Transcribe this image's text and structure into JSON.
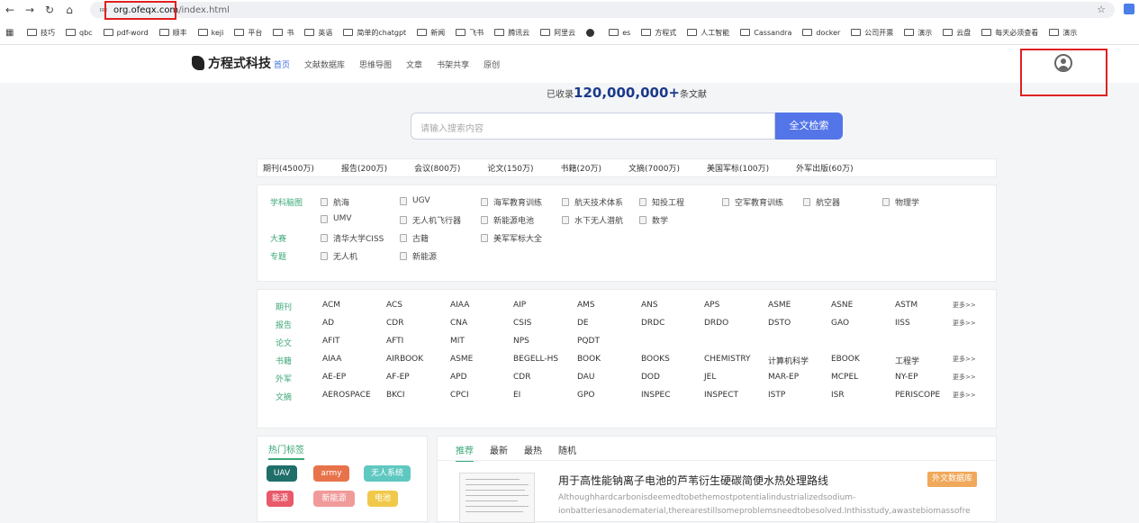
{
  "browser": {
    "url_host": "org.ofeqx.com",
    "url_path": "/index.html",
    "bookmarks": [
      "技巧",
      "qbc",
      "pdf-word",
      "顺丰",
      "keji",
      "平台",
      "书",
      "英语",
      "简单的chatgpt",
      "新闻",
      "飞书",
      "腾讯云",
      "阿里云",
      "",
      "es",
      "方程式",
      "人工智能",
      "Cassandra",
      "docker",
      "公司开票",
      "演示",
      "云盘",
      "每天必须查看",
      "演示"
    ]
  },
  "header": {
    "logo_text": "方程式科技",
    "nav": [
      "首页",
      "文献数据库",
      "思维导图",
      "文章",
      "书架共享",
      "原创"
    ]
  },
  "count": {
    "prefix": "已收录",
    "number": "120,000,000+",
    "suffix": "条文献"
  },
  "search": {
    "placeholder": "请输入搜索内容",
    "button": "全文检索"
  },
  "stats": [
    "期刊(4500万)",
    "报告(200万)",
    "会议(800万)",
    "论文(150万)",
    "书籍(20万)",
    "文摘(7000万)",
    "美国军标(100万)",
    "外军出版(60万)"
  ],
  "subjects": {
    "label_map": "学科脑图",
    "label_big": "大赛",
    "label_topic": "专题",
    "items": [
      "航海",
      "UGV",
      "海军教育训练",
      "航天技术体系",
      "知投工程",
      "空军教育训练",
      "航空器",
      "物理学",
      "UMV",
      "无人机飞行器",
      "新能源电池",
      "水下无人潜航",
      "数学",
      "清华大学CISS",
      "古籍",
      "美军军标大全",
      "无人机",
      "新能源"
    ]
  },
  "db": {
    "more": "更多>>",
    "rows": [
      {
        "label": "期刊",
        "cells": [
          "ACM",
          "ACS",
          "AIAA",
          "AIP",
          "AMS",
          "ANS",
          "APS",
          "ASME",
          "ASNE",
          "ASTM"
        ],
        "more": true
      },
      {
        "label": "报告",
        "cells": [
          "AD",
          "CDR",
          "CNA",
          "CSIS",
          "DE",
          "DRDC",
          "DRDO",
          "DSTO",
          "GAO",
          "IISS"
        ],
        "more": true
      },
      {
        "label": "论文",
        "cells": [
          "AFIT",
          "AFTI",
          "MIT",
          "NPS",
          "PQDT"
        ],
        "more": false
      },
      {
        "label": "书籍",
        "cells": [
          "AIAA",
          "AIRBOOK",
          "ASME",
          "BEGELL-HS",
          "BOOK",
          "BOOKS",
          "CHEMISTRY",
          "计算机科学",
          "EBOOK",
          "工程学"
        ],
        "more": true
      },
      {
        "label": "外军",
        "cells": [
          "AE-EP",
          "AF-EP",
          "APD",
          "CDR",
          "DAU",
          "DOD",
          "JEL",
          "MAR-EP",
          "MCPEL",
          "NY-EP"
        ],
        "more": true
      },
      {
        "label": "文摘",
        "cells": [
          "AEROSPACE",
          "BKCI",
          "CPCI",
          "EI",
          "GPO",
          "INSPEC",
          "INSPECT",
          "ISTP",
          "ISR",
          "PERISCOPE"
        ],
        "more": true
      }
    ]
  },
  "tags": {
    "title": "热门标签",
    "items": [
      {
        "text": "UAV",
        "color": "#1f6e6a"
      },
      {
        "text": "army",
        "color": "#e8734a"
      },
      {
        "text": "无人系统",
        "color": "#5fc8c0"
      },
      {
        "text": "能源",
        "color": "#e85a6a"
      },
      {
        "text": "新能源",
        "color": "#f19a9a"
      },
      {
        "text": "电池",
        "color": "#f0c94a"
      }
    ]
  },
  "feed": {
    "tabs": [
      "推荐",
      "最新",
      "最热",
      "随机"
    ],
    "title": "用于高性能钠离子电池的芦苇衍生硬碳简便水热处理路线",
    "abstract1": "Althoughhardcarbonisdeemedtobethemostpotentialindustrializedsodium-",
    "abstract2": "ionbatteriesanodematerial,therearestillsomeproblemsneedtobesolved.Inthisstudy,awastebiomassofre",
    "badge": "外文数据库"
  }
}
